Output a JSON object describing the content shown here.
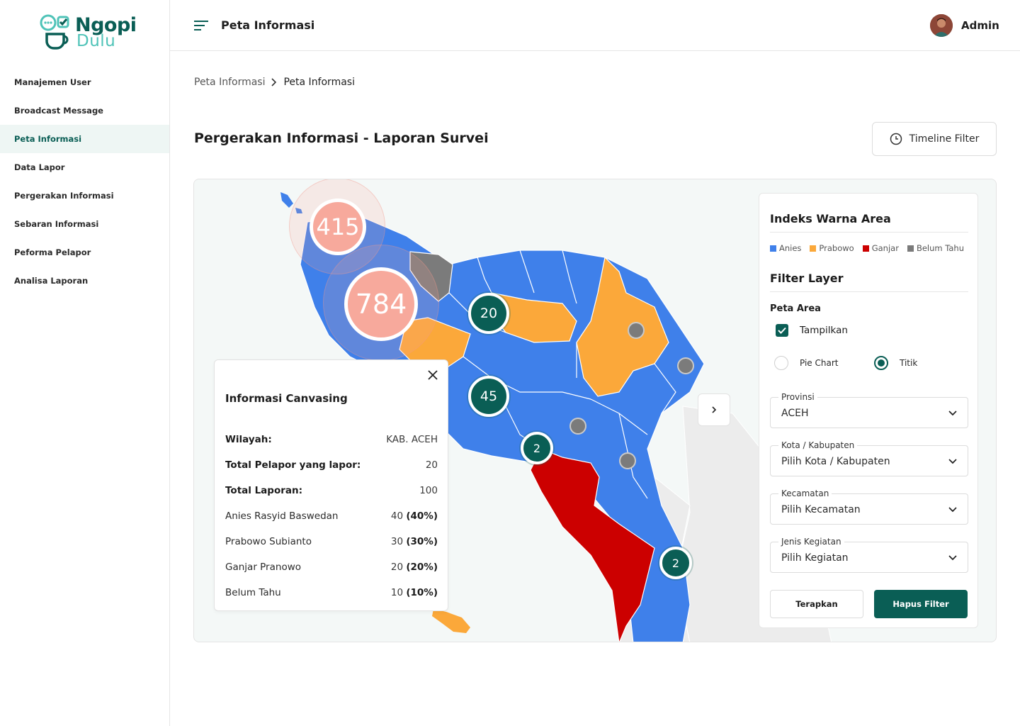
{
  "app": {
    "logo_line1": "Ngopi",
    "logo_line2": "Dulu"
  },
  "sidebar": {
    "items": [
      {
        "label": "Manajemen User"
      },
      {
        "label": "Broadcast Message"
      },
      {
        "label": "Peta Informasi",
        "active": true
      },
      {
        "label": "Data Lapor"
      },
      {
        "label": "Pergerakan Informasi"
      },
      {
        "label": "Sebaran Informasi"
      },
      {
        "label": "Peforma Pelapor"
      },
      {
        "label": "Analisa Laporan"
      }
    ]
  },
  "header": {
    "title": "Peta Informasi",
    "user_name": "Admin"
  },
  "breadcrumb": [
    "Peta Informasi",
    "Peta Informasi"
  ],
  "page": {
    "title": "Pergerakan Informasi - Laporan Survei",
    "timeline_button": "Timeline Filter"
  },
  "map": {
    "clusters": {
      "c415": "415",
      "c784": "784",
      "c20": "20",
      "c45": "45",
      "c2a": "2",
      "c2b": "2"
    }
  },
  "info_card": {
    "title": "Informasi Canvasing",
    "rows": [
      {
        "label": "Wilayah:",
        "value": "KAB. ACEH"
      },
      {
        "label": "Total Pelapor yang lapor:",
        "value": "20"
      },
      {
        "label": "Total Laporan:",
        "value": "100"
      },
      {
        "label": "Anies Rasyid Baswedan",
        "value": "40",
        "pct": "(40%)"
      },
      {
        "label": "Prabowo Subianto",
        "value": "30",
        "pct": "(30%)"
      },
      {
        "label": "Ganjar Pranowo",
        "value": "20",
        "pct": "(20%)"
      },
      {
        "label": "Belum Tahu",
        "value": "10",
        "pct": "(10%)"
      }
    ]
  },
  "filter_panel": {
    "legend_title": "Indeks Warna Area",
    "legend": [
      {
        "label": "Anies",
        "color": "#3f80ea"
      },
      {
        "label": "Prabowo",
        "color": "#fba83a"
      },
      {
        "label": "Ganjar",
        "color": "#cc0000"
      },
      {
        "label": "Belum Tahu",
        "color": "#7b7b7b"
      }
    ],
    "layer_title": "Filter Layer",
    "peta_area": "Peta Area",
    "show_label": "Tampilkan",
    "radio_pie": "Pie Chart",
    "radio_titik": "Titik",
    "selects": [
      {
        "label": "Provinsi",
        "value": "ACEH"
      },
      {
        "label": "Kota / Kabupaten",
        "value": "Pilih Kota / Kabupaten"
      },
      {
        "label": "Kecamatan",
        "value": "Pilih Kecamatan"
      },
      {
        "label": "Jenis Kegiatan",
        "value": "Pilih Kegiatan"
      }
    ],
    "apply_label": "Terapkan",
    "clear_label": "Hapus Filter"
  },
  "colors": {
    "brand": "#0a5e55",
    "anies": "#3f80ea",
    "prabowo": "#fba83a",
    "ganjar": "#cc0000",
    "unknown": "#7b7b7b"
  }
}
